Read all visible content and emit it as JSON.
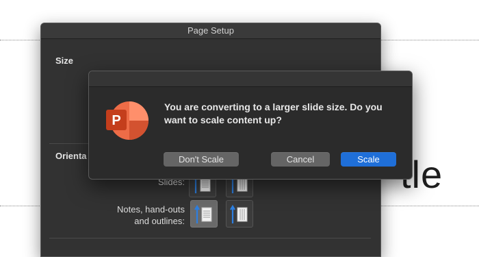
{
  "background_slide": {
    "title_fragment": "tle"
  },
  "page_setup": {
    "title": "Page Setup",
    "size_section_label": "Size",
    "orientation_section_label": "Orienta",
    "slides_label": "Slides:",
    "notes_label_line1": "Notes, hand-outs",
    "notes_label_line2": "and outlines:"
  },
  "alert": {
    "message": "You are converting to a larger slide size. Do you want to scale content up?",
    "buttons": {
      "dont_scale": "Don't Scale",
      "cancel": "Cancel",
      "scale": "Scale"
    },
    "icon_letter": "P"
  },
  "colors": {
    "accent_blue": "#1f6fd8",
    "powerpoint_orange": "#d24726",
    "dialog_bg": "#2b2b2b"
  },
  "icons": {
    "app_icon": "powerpoint-icon",
    "portrait": "portrait-orientation-icon",
    "landscape": "landscape-orientation-icon"
  }
}
